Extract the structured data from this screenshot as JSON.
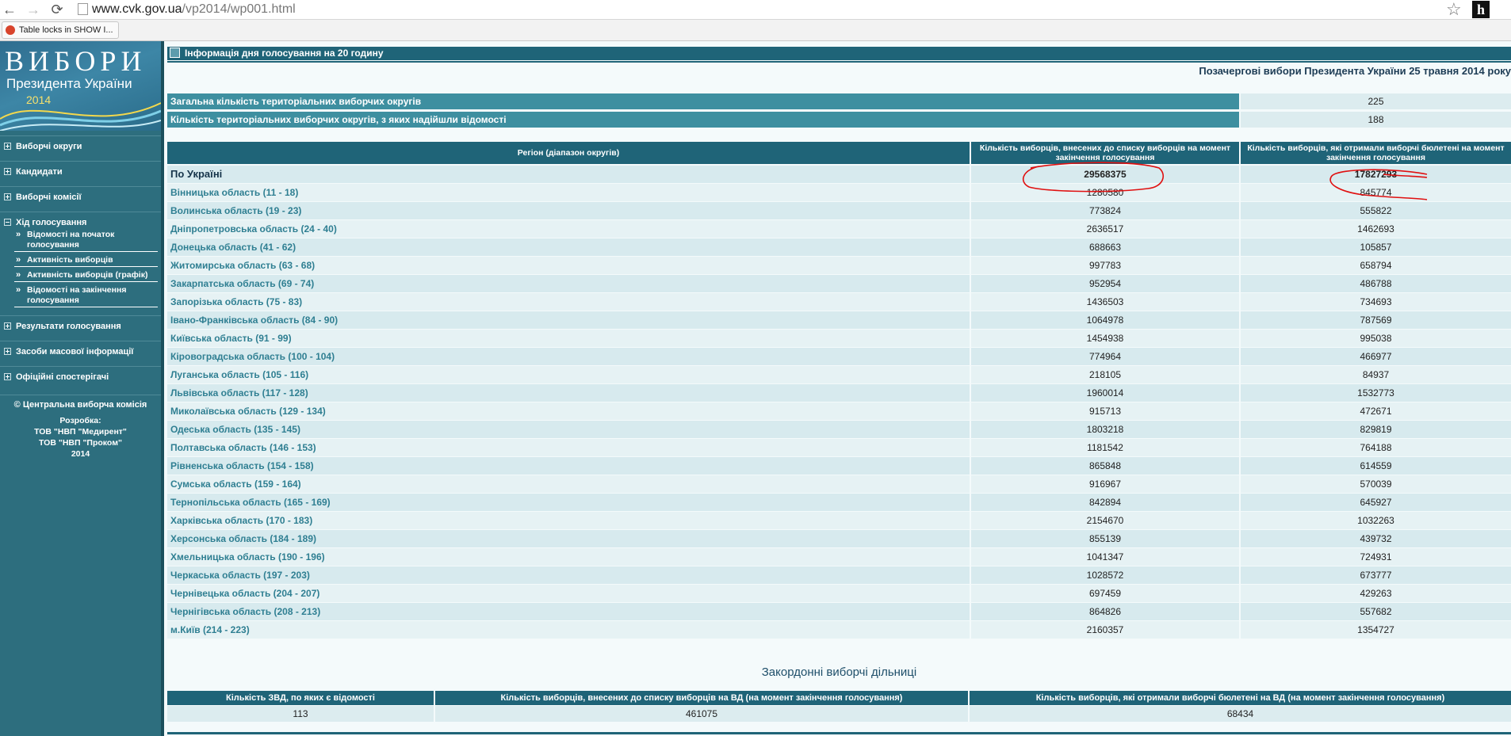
{
  "browser": {
    "url_host": "www.cvk.gov.ua",
    "url_path": "/vp2014/wp001.html",
    "bookmark": "Table locks in SHOW I..."
  },
  "sidebar": {
    "logo_title": "ВИБОРИ",
    "logo_subtitle": "Президента України",
    "logo_year": "2014",
    "menu": [
      "Виборчі округи",
      "Кандидати",
      "Виборчі комісії",
      "Хід голосування",
      "Результати голосування",
      "Засоби масової інформації",
      "Офіційні спостерігачі"
    ],
    "submenu": [
      "Відомості на початок голосування",
      "Активність виборців",
      "Активність виборців (графік)",
      "Відомості на закінчення голосування"
    ],
    "copyright": "© Центральна виборча комісія",
    "dev": [
      "Розробка:",
      "ТОВ \"НВП \"Медирент\"",
      "ТОВ \"НВП \"Проком\"",
      "2014"
    ]
  },
  "main": {
    "header": "Інформація дня голосування на 20 годину",
    "subtitle": "Позачергові вибори Президента України 25 травня 2014 року",
    "summary": [
      {
        "label": "Загальна кількість територіальних виборчих округів",
        "value": "225"
      },
      {
        "label": "Кількість територіальних виборчих округів, з яких надійшли відомості",
        "value": "188"
      }
    ],
    "columns": [
      "Регіон (діапазон округів)",
      "Кількість виборців, внесених до списку виборців на момент закінчення голосування",
      "Кількість виборців, які отримали виборчі бюлетені на момент закінчення голосування"
    ],
    "rows": [
      [
        "По Україні",
        "29568375",
        "17827293"
      ],
      [
        "Вінницька область (11 - 18)",
        "1280580",
        "845774"
      ],
      [
        "Волинська область (19 - 23)",
        "773824",
        "555822"
      ],
      [
        "Дніпропетровська область (24 - 40)",
        "2636517",
        "1462693"
      ],
      [
        "Донецька область (41 - 62)",
        "688663",
        "105857"
      ],
      [
        "Житомирська область (63 - 68)",
        "997783",
        "658794"
      ],
      [
        "Закарпатська область (69 - 74)",
        "952954",
        "486788"
      ],
      [
        "Запорізька область (75 - 83)",
        "1436503",
        "734693"
      ],
      [
        "Івано-Франківська область (84 - 90)",
        "1064978",
        "787569"
      ],
      [
        "Київська область (91 - 99)",
        "1454938",
        "995038"
      ],
      [
        "Кіровоградська область (100 - 104)",
        "774964",
        "466977"
      ],
      [
        "Луганська область (105 - 116)",
        "218105",
        "84937"
      ],
      [
        "Львівська область (117 - 128)",
        "1960014",
        "1532773"
      ],
      [
        "Миколаївська область (129 - 134)",
        "915713",
        "472671"
      ],
      [
        "Одеська область (135 - 145)",
        "1803218",
        "829819"
      ],
      [
        "Полтавська область (146 - 153)",
        "1181542",
        "764188"
      ],
      [
        "Рівненська область (154 - 158)",
        "865848",
        "614559"
      ],
      [
        "Сумська область (159 - 164)",
        "916967",
        "570039"
      ],
      [
        "Тернопільська область (165 - 169)",
        "842894",
        "645927"
      ],
      [
        "Харківська область (170 - 183)",
        "2154670",
        "1032263"
      ],
      [
        "Херсонська область (184 - 189)",
        "855139",
        "439732"
      ],
      [
        "Хмельницька область (190 - 196)",
        "1041347",
        "724931"
      ],
      [
        "Черкаська область (197 - 203)",
        "1028572",
        "673777"
      ],
      [
        "Чернівецька область (204 - 207)",
        "697459",
        "429263"
      ],
      [
        "Чернігівська область (208 - 213)",
        "864826",
        "557682"
      ],
      [
        "м.Київ (214 - 223)",
        "2160357",
        "1354727"
      ]
    ],
    "abroad": {
      "title": "Закордонні виборчі дільниці",
      "columns": [
        "Кількість ЗВД, по яких є відомості",
        "Кількість виборців, внесених до списку виборців на ВД (на момент закінчення голосування)",
        "Кількість виборців, які отримали виборчі бюлетені на ВД (на момент закінчення голосування)"
      ],
      "values": [
        "113",
        "461075",
        "68434"
      ]
    }
  }
}
